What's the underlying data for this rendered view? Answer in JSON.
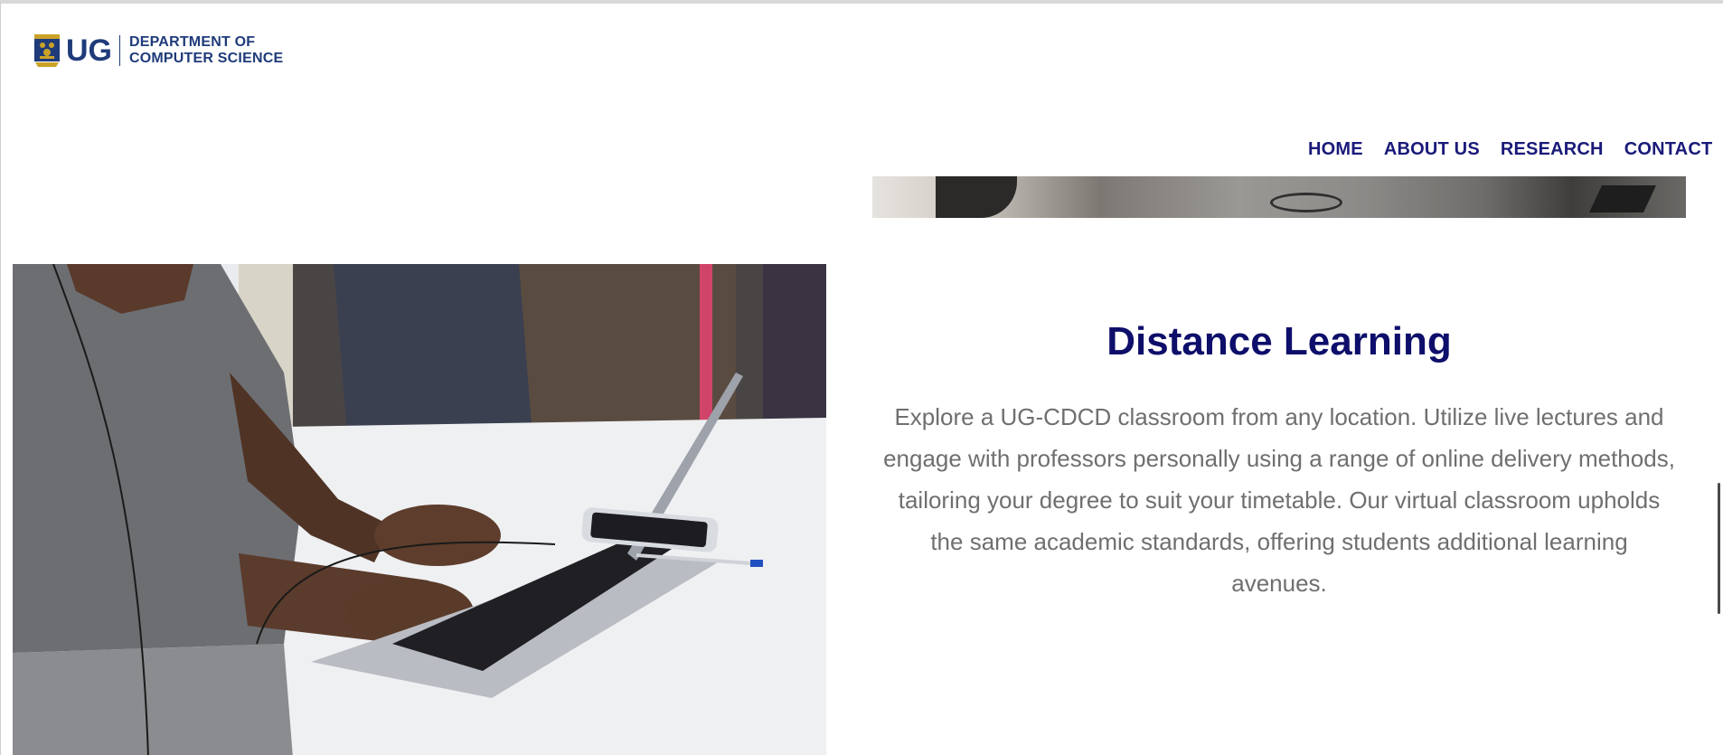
{
  "header": {
    "logo_abbrev": "UG",
    "dept_line1": "DEPARTMENT OF",
    "dept_line2": "COMPUTER SCIENCE",
    "crest_icon": "university-crest-icon"
  },
  "nav": {
    "items": [
      {
        "label": "HOME"
      },
      {
        "label": "ABOUT US"
      },
      {
        "label": "RESEARCH"
      },
      {
        "label": "CONTACT"
      }
    ]
  },
  "section": {
    "title": "Distance Learning",
    "body": "Explore a UG-CDCD classroom from any location. Utilize live lectures and engage with professors personally using a range of online delivery methods, tailoring your degree to suit your timetable. Our virtual classroom upholds the same academic standards, offering students additional learning avenues."
  },
  "colors": {
    "brand_navy": "#1f3b7a",
    "title_navy": "#0e0e6b",
    "nav_text": "#1a1a7a",
    "body_text": "#6f6f6f"
  }
}
